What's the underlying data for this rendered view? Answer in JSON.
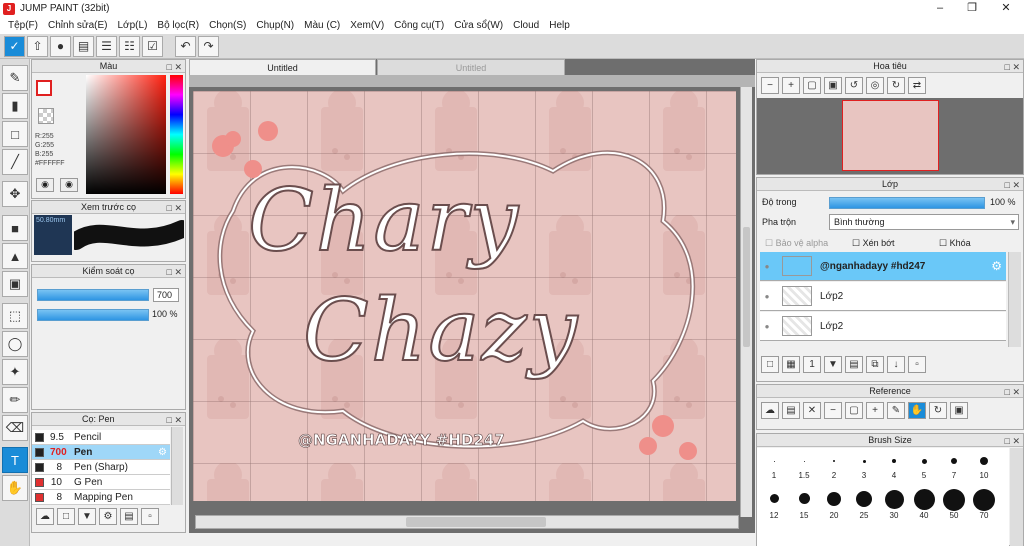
{
  "window": {
    "title": "JUMP PAINT (32bit)",
    "icon": "jump-paint-logo-icon"
  },
  "menu": [
    "Tệp(F)",
    "Chỉnh sửa(E)",
    "Lớp(L)",
    "Bộ lọc(R)",
    "Chọn(S)",
    "Chụp(N)",
    "Màu (C)",
    "Xem(V)",
    "Công cụ(T)",
    "Cửa sổ(W)",
    "Cloud",
    "Help"
  ],
  "color_panel": {
    "title": "Màu",
    "r": "R:255",
    "g": "G:255",
    "b": "B:255",
    "hex": "#FFFFFF",
    "fg": "#ffffff",
    "hue_accent": "#e82020"
  },
  "brush_preview": {
    "title": "Xem trước cọ",
    "size": "50.80mm"
  },
  "brush_control": {
    "title": "Kiểm soát cọ",
    "size_value": "700",
    "opacity_value": "100 %"
  },
  "brush_list": {
    "title": "Cọ: Pen",
    "items": [
      {
        "size": "9.5",
        "name": "Pencil",
        "color": "#222222"
      },
      {
        "size": "700",
        "name": "Pen",
        "color": "#222222",
        "selected": true
      },
      {
        "size": "8",
        "name": "Pen (Sharp)",
        "color": "#222222"
      },
      {
        "size": "10",
        "name": "G Pen",
        "color": "#e03030"
      },
      {
        "size": "8",
        "name": "Mapping Pen",
        "color": "#e03030"
      }
    ]
  },
  "tabs": [
    "Untitled",
    "Untitled"
  ],
  "artwork": {
    "line1": "Chary",
    "line2": "Chazy",
    "signature": "@NGANHADAYY #HD247"
  },
  "navigator": {
    "title": "Hoa tiêu"
  },
  "layer_panel": {
    "title": "Lớp",
    "opacity_label": "Độ trong",
    "opacity_value": "100 %",
    "blend_label": "Pha trộn",
    "blend_value": "Bình thường",
    "protect_alpha": "Bảo vệ alpha",
    "clipping": "Xén bớt",
    "lock": "Khóa",
    "layers": [
      {
        "name": "@nganhadayy #hd247",
        "selected": true
      },
      {
        "name": "Lớp2",
        "selected": false
      },
      {
        "name": "Lớp2",
        "selected": false
      }
    ]
  },
  "reference": {
    "title": "Reference"
  },
  "brush_size": {
    "title": "Brush Size",
    "sizes": [
      "1",
      "1.5",
      "2",
      "3",
      "4",
      "5",
      "7",
      "10",
      "12",
      "15",
      "20",
      "25",
      "30",
      "40",
      "50",
      "70"
    ]
  }
}
